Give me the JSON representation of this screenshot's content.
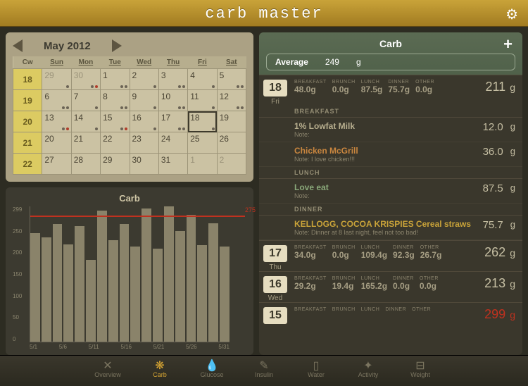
{
  "app": {
    "title": "carb master"
  },
  "calendar": {
    "month_label": "May 2012",
    "day_headers": [
      "Cw",
      "Sun",
      "Mon",
      "Tue",
      "Wed",
      "Thu",
      "Fri",
      "Sat"
    ],
    "weeks": [
      {
        "cw": "18",
        "days": [
          {
            "n": "29",
            "out": true,
            "dots": [
              "g"
            ]
          },
          {
            "n": "30",
            "out": true,
            "dots": [
              "g",
              "r"
            ]
          },
          {
            "n": "1",
            "dots": [
              "g",
              "g"
            ]
          },
          {
            "n": "2",
            "dots": [
              "g"
            ]
          },
          {
            "n": "3",
            "dots": [
              "g",
              "g"
            ]
          },
          {
            "n": "4",
            "dots": [
              "g"
            ]
          },
          {
            "n": "5",
            "dots": [
              "g",
              "g"
            ]
          }
        ]
      },
      {
        "cw": "19",
        "days": [
          {
            "n": "6",
            "dots": [
              "g",
              "g"
            ]
          },
          {
            "n": "7",
            "dots": [
              "g"
            ]
          },
          {
            "n": "8",
            "dots": [
              "g",
              "g"
            ]
          },
          {
            "n": "9",
            "dots": [
              "g"
            ]
          },
          {
            "n": "10",
            "dots": [
              "g",
              "g"
            ]
          },
          {
            "n": "11",
            "dots": [
              "g"
            ]
          },
          {
            "n": "12",
            "dots": [
              "g",
              "g"
            ]
          }
        ]
      },
      {
        "cw": "20",
        "days": [
          {
            "n": "13",
            "dots": [
              "g",
              "r"
            ]
          },
          {
            "n": "14",
            "dots": [
              "g"
            ]
          },
          {
            "n": "15",
            "dots": [
              "g",
              "r"
            ]
          },
          {
            "n": "16",
            "dots": [
              "g"
            ]
          },
          {
            "n": "17",
            "dots": [
              "g",
              "g"
            ]
          },
          {
            "n": "18",
            "today": true,
            "dots": [
              "g"
            ]
          },
          {
            "n": "19"
          }
        ]
      },
      {
        "cw": "21",
        "days": [
          {
            "n": "20"
          },
          {
            "n": "21"
          },
          {
            "n": "22"
          },
          {
            "n": "23"
          },
          {
            "n": "24"
          },
          {
            "n": "25"
          },
          {
            "n": "26"
          }
        ]
      },
      {
        "cw": "22",
        "days": [
          {
            "n": "27"
          },
          {
            "n": "28"
          },
          {
            "n": "29"
          },
          {
            "n": "30"
          },
          {
            "n": "31"
          },
          {
            "n": "1",
            "out": true
          },
          {
            "n": "2",
            "out": true
          }
        ]
      }
    ]
  },
  "chart_data": {
    "type": "bar",
    "title": "Carb",
    "ylim": [
      0,
      299
    ],
    "y_ticks": [
      "299",
      "250",
      "200",
      "150",
      "100",
      "50",
      "0"
    ],
    "x_ticks": [
      "5/1",
      "5/6",
      "5/11",
      "5/16",
      "5/21",
      "5/26",
      "5/31"
    ],
    "reference_line": 275,
    "note": "Bar heights estimated from pixels relative to y-axis (g)",
    "values": [
      240,
      230,
      260,
      215,
      255,
      180,
      290,
      225,
      260,
      210,
      295,
      206,
      299,
      245,
      280,
      213,
      262,
      211
    ]
  },
  "right": {
    "title": "Carb",
    "avg_label": "Average",
    "avg_value": "249",
    "avg_unit": "g",
    "meal_labels": [
      "BREAKFAST",
      "BRUNCH",
      "LUNCH",
      "DINNER",
      "OTHER"
    ],
    "section_labels": {
      "breakfast": "BREAKFAST",
      "lunch": "LUNCH",
      "dinner": "DINNER"
    },
    "note_prefix": "Note:",
    "unit": "g"
  },
  "days": [
    {
      "num": "18",
      "dow": "Fri",
      "total": "211",
      "total_red": false,
      "meals": [
        "48.0g",
        "0.0g",
        "87.5g",
        "75.7g",
        "0.0g"
      ],
      "sections": [
        {
          "label": "breakfast",
          "items": [
            {
              "name": "1% Lowfat Milk",
              "note": "",
              "val": "12.0",
              "cls": "c-milk"
            },
            {
              "name": "Chicken McGrill",
              "note": "I love chicken!!!",
              "val": "36.0",
              "cls": "c-orange"
            }
          ]
        },
        {
          "label": "lunch",
          "items": [
            {
              "name": "Love eat",
              "note": "",
              "val": "87.5",
              "cls": "c-green"
            }
          ]
        },
        {
          "label": "dinner",
          "items": [
            {
              "name": "KELLOGG, COCOA KRISPIES Cereal straws",
              "note": "Dinner at 8 last night, feel not too bad!",
              "val": "75.7",
              "cls": "c-yel"
            }
          ]
        }
      ]
    },
    {
      "num": "17",
      "dow": "Thu",
      "total": "262",
      "total_red": false,
      "meals": [
        "34.0g",
        "0.0g",
        "109.4g",
        "92.3g",
        "26.7g"
      ],
      "sections": []
    },
    {
      "num": "16",
      "dow": "Wed",
      "total": "213",
      "total_red": false,
      "meals": [
        "29.2g",
        "19.4g",
        "165.2g",
        "0.0g",
        "0.0g"
      ],
      "sections": []
    },
    {
      "num": "15",
      "dow": "",
      "total": "299",
      "total_red": true,
      "meals": [
        "",
        "",
        "",
        "",
        ""
      ],
      "sections": []
    }
  ],
  "tabs": [
    {
      "label": "Overview",
      "icon": "✕"
    },
    {
      "label": "Carb",
      "icon": "❋",
      "sel": true
    },
    {
      "label": "Glucose",
      "icon": "💧"
    },
    {
      "label": "Insulin",
      "icon": "✎"
    },
    {
      "label": "Water",
      "icon": "▯"
    },
    {
      "label": "Activity",
      "icon": "✦"
    },
    {
      "label": "Weight",
      "icon": "⊟"
    }
  ]
}
